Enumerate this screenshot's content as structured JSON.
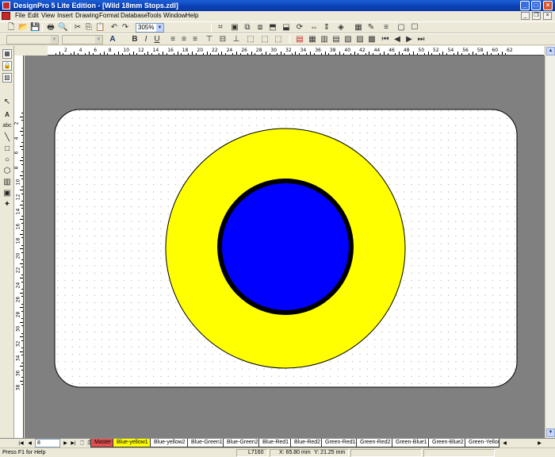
{
  "window": {
    "title": "DesignPro 5 Lite Edition - [Wild 18mm Stops.zdl]"
  },
  "menu": [
    "File",
    "Edit",
    "View",
    "Insert",
    "Drawing",
    "Format",
    "Database",
    "Tools",
    "Window",
    "Help"
  ],
  "toolbar": {
    "zoom_value": "305%"
  },
  "rulers": {
    "horizontal_labels": [
      "2",
      "4",
      "6",
      "8",
      "10",
      "12",
      "14",
      "16",
      "18",
      "20",
      "22",
      "24",
      "26",
      "28",
      "30",
      "32",
      "34",
      "36",
      "38",
      "40",
      "42",
      "44",
      "46",
      "48",
      "50",
      "52",
      "54",
      "56",
      "58",
      "60",
      "62"
    ],
    "vertical_labels": [
      "2",
      "4",
      "6",
      "8",
      "10",
      "12",
      "14",
      "16",
      "18",
      "20",
      "22",
      "24",
      "26",
      "28",
      "30",
      "32",
      "34",
      "36",
      "38"
    ]
  },
  "label_design": {
    "background_color": "#ffffff",
    "outer_circle_color": "#ffff00",
    "inner_circle_color": "#0000ff",
    "inner_ring_color": "#000000",
    "workspace_color": "#808080"
  },
  "page_nav": {
    "page_number": "8"
  },
  "page_tabs": [
    "Master",
    "Blue-yellow1",
    "Blue-yellow2",
    "Blue-Green1",
    "Blue-Green2",
    "Blue-Red1",
    "Blue-Red2",
    "Green-Red1",
    "Green-Red2",
    "Green-Blue1",
    "Green-Blue2",
    "Green-Yellow"
  ],
  "status": {
    "help": "Press F1 for Help",
    "product": "L7160",
    "x_coord": "X: 65.80 mm",
    "y_coord": "Y: 21.25 mm"
  }
}
